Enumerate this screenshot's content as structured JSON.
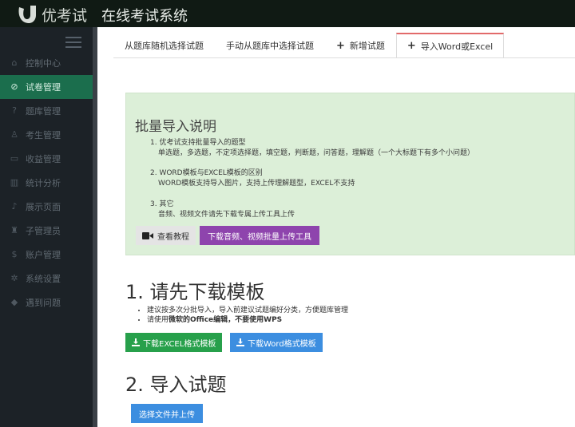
{
  "header": {
    "brand": "优考试",
    "system_title": "在线考试系统"
  },
  "sidebar": {
    "items": [
      {
        "label": "控制中心",
        "icon": "home-icon"
      },
      {
        "label": "试卷管理",
        "icon": "check-circle-icon",
        "active": true
      },
      {
        "label": "题库管理",
        "icon": "question-circle-icon"
      },
      {
        "label": "考生管理",
        "icon": "users-icon"
      },
      {
        "label": "收益管理",
        "icon": "credit-card-icon"
      },
      {
        "label": "统计分析",
        "icon": "bar-chart-icon"
      },
      {
        "label": "展示页面",
        "icon": "bell-icon"
      },
      {
        "label": "子管理员",
        "icon": "lock-icon"
      },
      {
        "label": "账户管理",
        "icon": "dollar-icon"
      },
      {
        "label": "系统设置",
        "icon": "gear-icon"
      },
      {
        "label": "遇到问题",
        "icon": "diamond-icon"
      }
    ]
  },
  "tabs": [
    {
      "label": "从题库随机选择试题"
    },
    {
      "label": "手动从题库中选择试题"
    },
    {
      "label": "新增试题",
      "plus": "+"
    },
    {
      "label": "导入Word或Excel",
      "plus": "+",
      "active": true
    }
  ],
  "instructions": {
    "title": "批量导入说明",
    "items": [
      {
        "line1": "1. 优考试支持批量导入的题型",
        "line2": "单选题，多选题，不定项选择题，填空题，判断题，问答题，理解题（一个大标题下有多个小问题）"
      },
      {
        "line1": "2. WORD模板与EXCEL模板的区别",
        "line2": "WORD模板支持导入图片，支持上传理解题型，EXCEL不支持"
      },
      {
        "line1": "3. 其它",
        "line2": "音频、视频文件请先下载专属上传工具上传"
      }
    ],
    "tutorial_button": "查看教程",
    "upload_tool_button": "下载音频、视频批量上传工具"
  },
  "step1": {
    "title": "1. 请先下载模板",
    "bullet1": "建议按多次分批导入，导入前建议试题编好分类，方便题库管理",
    "bullet2_prefix": "请使用",
    "bullet2_bold": "微软的Office编辑，不要使用WPS",
    "excel_button": "下载EXCEL格式模板",
    "word_button": "下载Word格式模板"
  },
  "step2": {
    "title": "2. 导入试题",
    "select_button": "选择文件并上传"
  },
  "colors": {
    "sidebar_active": "#1b6e4d",
    "panel_bg": "#dcefd8",
    "purple": "#8e44ad",
    "green": "#27a04b",
    "blue": "#3c8ee0",
    "tab_accent": "#e26a6a"
  }
}
